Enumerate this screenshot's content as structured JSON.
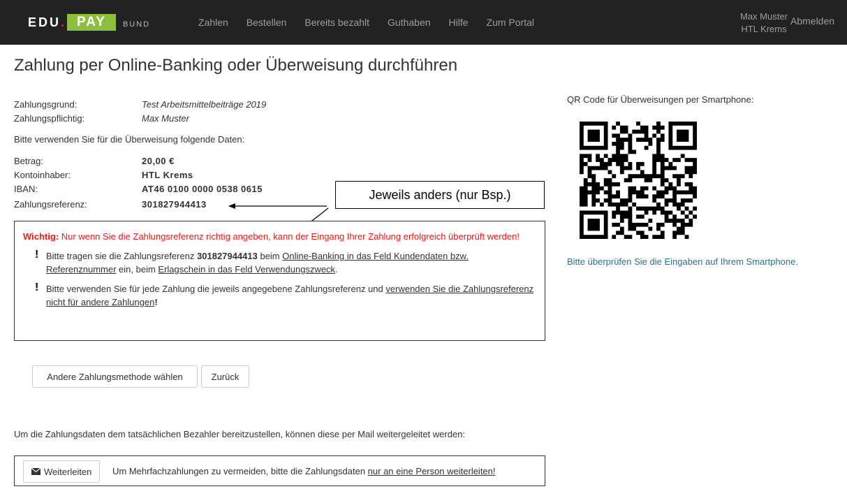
{
  "navbar": {
    "logo_edu": "EDU",
    "logo_dot": ".",
    "logo_pay": "PAY",
    "logo_bund": "BUND",
    "items": [
      "Zahlen",
      "Bestellen",
      "Bereits bezahlt",
      "Guthaben",
      "Hilfe",
      "Zum Portal"
    ],
    "user_name": "Max Muster",
    "user_school": "HTL Krems",
    "logout": "Abmelden"
  },
  "page_title": "Zahlung per Online-Banking oder Überweisung durchführen",
  "details": {
    "grund_label": "Zahlungsgrund:",
    "grund_value": "Test Arbeitsmittelbeiträge 2019",
    "pflichtig_label": "Zahlungspflichtig:",
    "pflichtig_value": "Max Muster",
    "instruction": "Bitte verwenden Sie für die Überweisung folgende Daten:",
    "betrag_label": "Betrag:",
    "betrag_value": "20,00 €",
    "inhaber_label": "Kontoinhaber:",
    "inhaber_value": "HTL Krems",
    "iban_label": "IBAN:",
    "iban_value": "AT46 0100 0000 0538 0615",
    "referenz_label": "Zahlungsreferenz:",
    "referenz_value": "301827944413"
  },
  "annotation": "Jeweils anders (nur Bsp.)",
  "warning": {
    "strong": "Wichtig:",
    "text": " Nur wenn Sie die Zahlungsreferenz richtig angeben, kann der Eingang Ihrer Zahlung erfolgreich überprüft werden!",
    "b1_a": "Bitte tragen sie die Zahlungsreferenz ",
    "b1_ref": "301827944413",
    "b1_b": " beim ",
    "b1_link1": "Online-Banking in das Feld Kundendaten bzw. Referenznummer",
    "b1_c": " ein, beim ",
    "b1_link2": "Erlagschein in das Feld Verwendungszweck",
    "b1_d": ".",
    "b2_a": "Bitte verwenden Sie für jede Zahlung die jeweils angegebene Zahlungsreferenz und ",
    "b2_link": "verwenden Sie die Zahlungsreferenz nicht für andere Zahlungen",
    "b2_end": "!"
  },
  "buttons": {
    "other_method": "Andere Zahlungsmethode wählen",
    "back": "Zurück"
  },
  "qr": {
    "title": "QR Code für Überweisungen per Smartphone:",
    "hint": "Bitte überprüfen Sie die Eingaben auf Ihrem Smartphone."
  },
  "forward": {
    "text": "Um die Zahlungsdaten dem tatsächlichen Bezahler bereitzustellen, können diese per Mail weitergeleitet werden:",
    "button": "Weiterleiten",
    "msg_a": "Um Mehrfachzahlungen zu vermeiden, bitte die Zahlungsdaten ",
    "msg_link": "nur an eine Person weiterleiten!"
  },
  "colors": {
    "navbar": "#222222",
    "pay_green": "#8bbf3d",
    "warning_red": "#e3211d",
    "hint_blue": "#31708f"
  }
}
